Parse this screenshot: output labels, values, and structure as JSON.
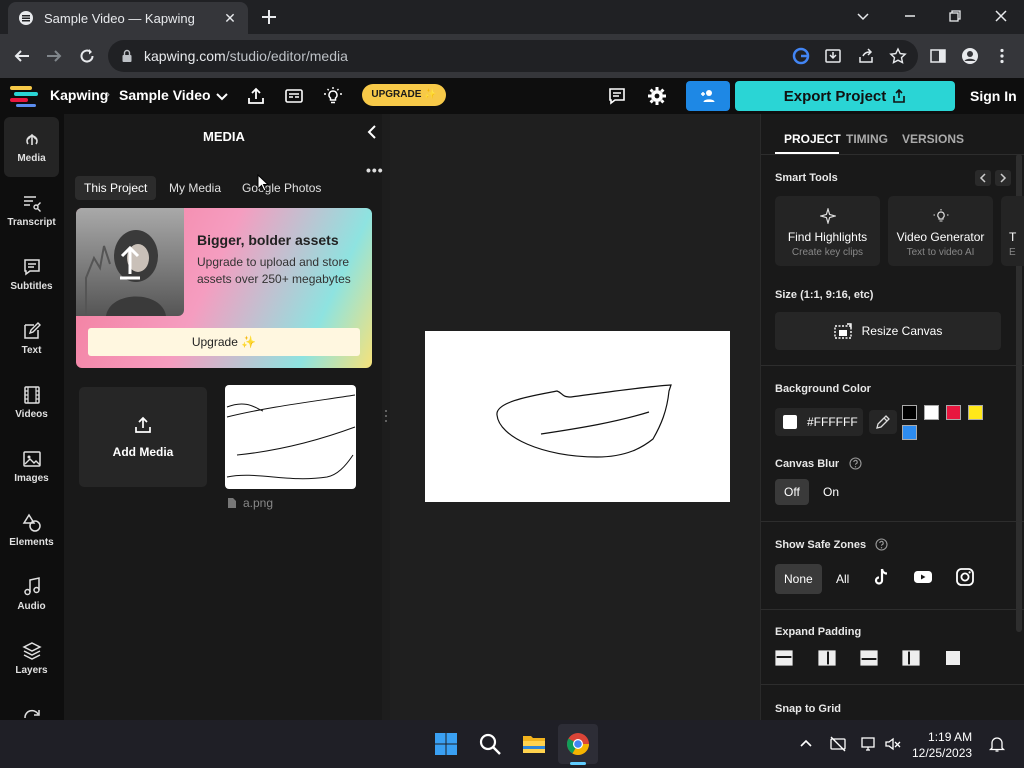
{
  "browser": {
    "tab_title": "Sample Video — Kapwing",
    "url_host": "kapwing.com",
    "url_path": "/studio/editor/media"
  },
  "header": {
    "brand": "Kapwing",
    "separator": "›",
    "project_name": "Sample Video",
    "upgrade_label": "UPGRADE ✨",
    "export_label": "Export Project",
    "signin_label": "Sign In"
  },
  "rail": {
    "items": [
      {
        "label": "Media",
        "icon": "upload-icon",
        "active": true
      },
      {
        "label": "Transcript",
        "icon": "transcript-icon"
      },
      {
        "label": "Subtitles",
        "icon": "subtitles-icon"
      },
      {
        "label": "Text",
        "icon": "text-icon"
      },
      {
        "label": "Videos",
        "icon": "film-icon"
      },
      {
        "label": "Images",
        "icon": "image-icon"
      },
      {
        "label": "Elements",
        "icon": "shapes-icon"
      },
      {
        "label": "Audio",
        "icon": "music-icon"
      },
      {
        "label": "Layers",
        "icon": "layers-icon"
      }
    ]
  },
  "media": {
    "title": "MEDIA",
    "more": "•••",
    "tabs": [
      "This Project",
      "My Media",
      "Google Photos"
    ],
    "promo_title": "Bigger, bolder assets",
    "promo_text": "Upgrade to upload and store assets over 250+ megabytes",
    "promo_button": "Upgrade ✨",
    "add_media_label": "Add Media",
    "file_name": "a.png"
  },
  "right": {
    "tabs": [
      "PROJECT",
      "TIMING",
      "VERSIONS"
    ],
    "smart_tools_title": "Smart Tools",
    "tools": [
      {
        "name": "Find Highlights",
        "sub": "Create key clips"
      },
      {
        "name": "Video Generator",
        "sub": "Text to video AI"
      },
      {
        "name": "T",
        "sub": "E"
      }
    ],
    "size_title": "Size (1:1, 9:16, etc)",
    "resize_label": "Resize Canvas",
    "bg_title": "Background Color",
    "bg_value": "#FFFFFF",
    "swatches": [
      "#000000",
      "#ffffff",
      "#e8173f",
      "#ffe81a",
      "#2d8cf0"
    ],
    "blur_title": "Canvas Blur",
    "blur_options": [
      "Off",
      "On"
    ],
    "safe_title": "Show Safe Zones",
    "safe_options": [
      "None",
      "All"
    ],
    "padding_title": "Expand Padding",
    "snap_title": "Snap to Grid"
  },
  "taskbar": {
    "time": "1:19 AM",
    "date": "12/25/2023"
  },
  "colors": {
    "accent_cyan": "#2ad5d5",
    "accent_blue": "#1e88e5",
    "upgrade_yellow": "#f7c948"
  }
}
